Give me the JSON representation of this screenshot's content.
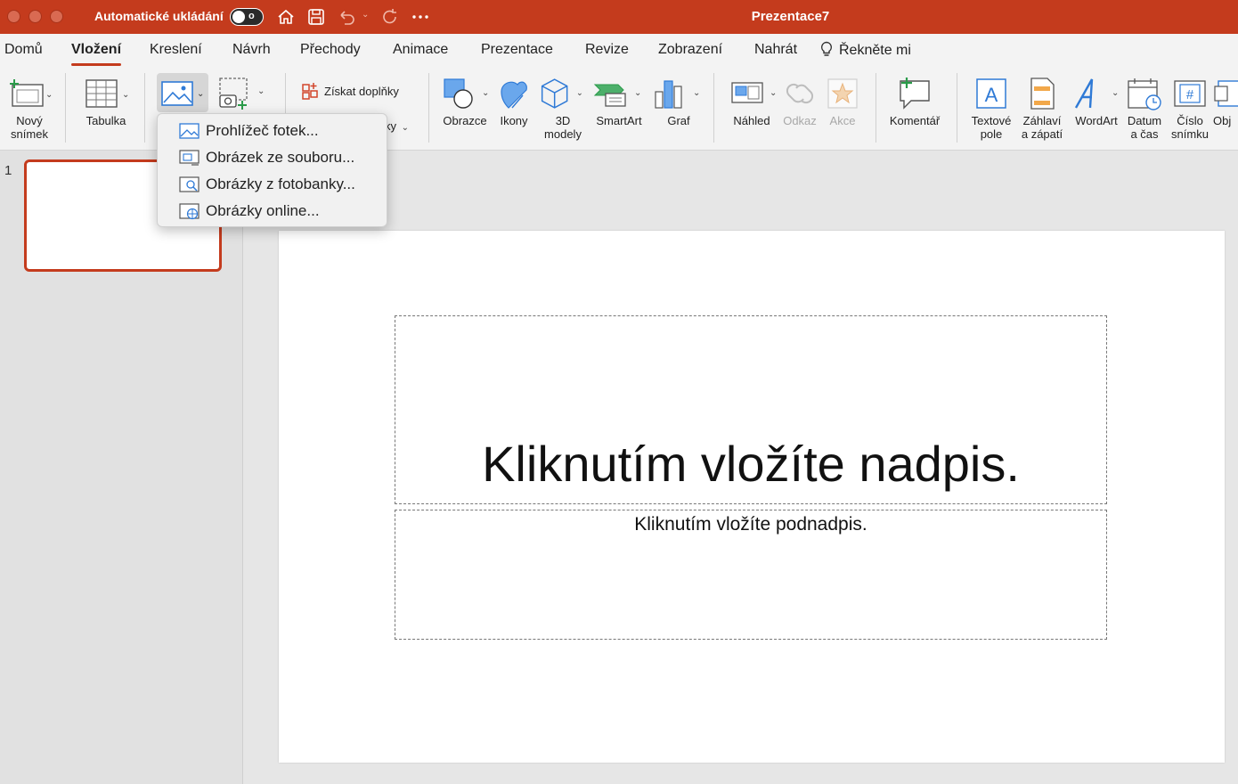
{
  "titlebar": {
    "autosave_label": "Automatické ukládání",
    "toggle_state": "o",
    "document_title": "Prezentace7",
    "icons": [
      "home-icon",
      "save-icon",
      "undo-icon",
      "redo-icon",
      "more-icon"
    ]
  },
  "tabs": [
    {
      "label": "Domů",
      "active": false
    },
    {
      "label": "Vložení",
      "active": true
    },
    {
      "label": "Kreslení",
      "active": false
    },
    {
      "label": "Návrh",
      "active": false
    },
    {
      "label": "Přechody",
      "active": false
    },
    {
      "label": "Animace",
      "active": false
    },
    {
      "label": "Prezentace",
      "active": false
    },
    {
      "label": "Revize",
      "active": false
    },
    {
      "label": "Zobrazení",
      "active": false
    },
    {
      "label": "Nahrát",
      "active": false
    }
  ],
  "tell_me": "Řekněte mi",
  "ribbon": {
    "new_slide": "Nový\nsnímek",
    "table": "Tabulka",
    "get_addins": "Získat doplňky",
    "addins_partial": "ky",
    "shapes": "Obrazce",
    "icons": "Ikony",
    "models_3d": "3D\nmodely",
    "smartart": "SmartArt",
    "chart": "Graf",
    "preview": "Náhled",
    "link": "Odkaz",
    "action": "Akce",
    "comment": "Komentář",
    "textbox": "Textové\npole",
    "header_footer": "Záhlaví\na zápatí",
    "wordart": "WordArt",
    "date_time": "Datum\na čas",
    "slide_number": "Číslo\nsnímku",
    "object_partial": "Obj"
  },
  "picture_menu": [
    {
      "label": "Prohlížeč fotek...",
      "icon": "photo-browser-icon"
    },
    {
      "label": "Obrázek ze souboru...",
      "icon": "picture-from-file-icon"
    },
    {
      "label": "Obrázky z fotobanky...",
      "icon": "stock-images-icon"
    },
    {
      "label": "Obrázky online...",
      "icon": "online-pictures-icon"
    }
  ],
  "slides_pane": {
    "slide_number": "1"
  },
  "slide": {
    "title_placeholder": "Kliknutím vložíte nadpis.",
    "subtitle_placeholder": "Kliknutím vložíte podnadpis."
  },
  "colors": {
    "accent": "#c43b1d",
    "ribbon_icon_blue": "#2f7ad6",
    "ribbon_icon_green": "#2b9b4a",
    "ribbon_icon_orange": "#e0892a"
  }
}
